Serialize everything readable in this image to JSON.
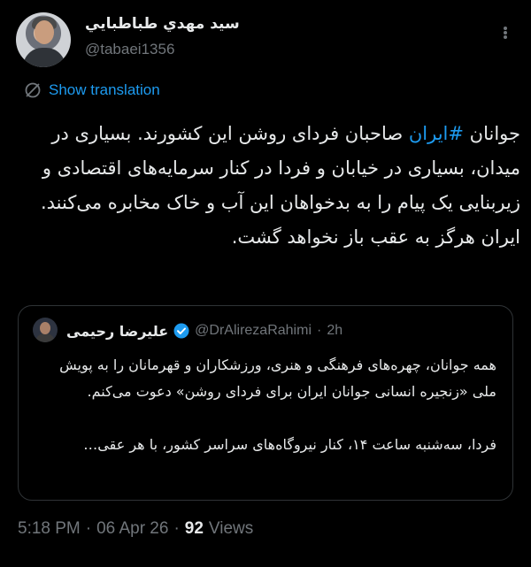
{
  "author": {
    "name": "سيد مهدي طباطبايي",
    "handle": "@tabaei1356"
  },
  "translate": {
    "label": "Show translation"
  },
  "tweet": {
    "text_before": "جوانان ",
    "hashtag": "#ایران",
    "text_after": " صاحبان فردای روشن این کشورند. بسیاری در میدان، بسیاری در خیابان و فردا در کنار سرمایه‌های اقتصادی و زیربنایی یک پیام را به بدخواهان این آب و خاک مخابره می‌کنند. ایران هرگز به عقب باز نخواهد گشت."
  },
  "quote": {
    "name": "علیرضا رحیمی",
    "handle": "@DrAlirezaRahimi",
    "separator": "·",
    "time": "2h",
    "paragraph1": "همه جوانان، چهره‌های فرهنگی و هنری، ورزشکاران و قهرمانان را به پویش ملی «زنجیره انسانی جوانان ایران برای فردای روشن» دعوت می‌کنم.",
    "paragraph2": "فردا، سه‌شنبه ساعت ۱۴، کنار نیروگاه‌های سراسر کشور، با هر عقی…"
  },
  "meta": {
    "time": "5:18 PM",
    "separator": "·",
    "date": "06 Apr 26",
    "views_count": "92",
    "views_label": "Views"
  },
  "colors": {
    "background": "#000000",
    "text": "#e7e9ea",
    "secondary": "#71767b",
    "accent": "#1d9bf0",
    "verified": "#1d9bf0"
  },
  "icons": {
    "more": "more-dots-icon",
    "translate": "translate-globe-icon",
    "verified": "verified-badge-icon"
  }
}
